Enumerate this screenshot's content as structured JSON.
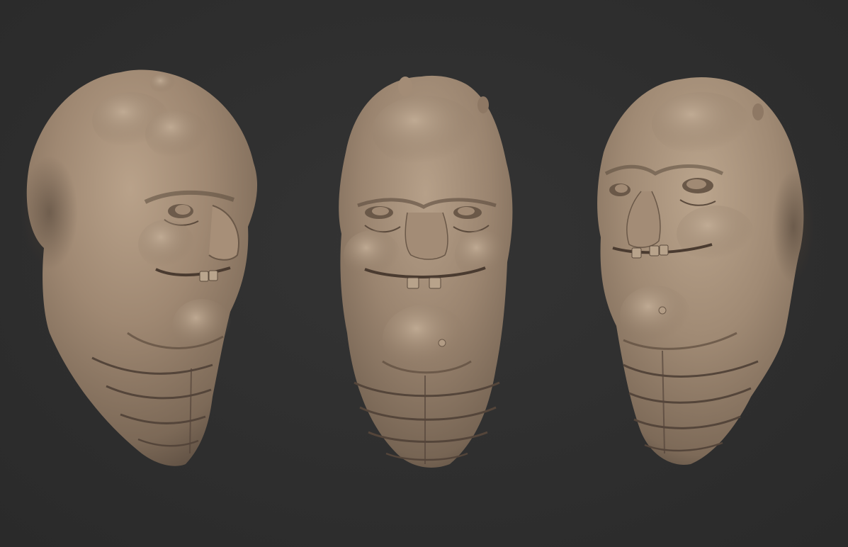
{
  "scene": {
    "background": "#2f2f2f",
    "material_color": "#9c8670",
    "views": [
      "three-quarter-right",
      "front",
      "three-quarter-left"
    ]
  }
}
